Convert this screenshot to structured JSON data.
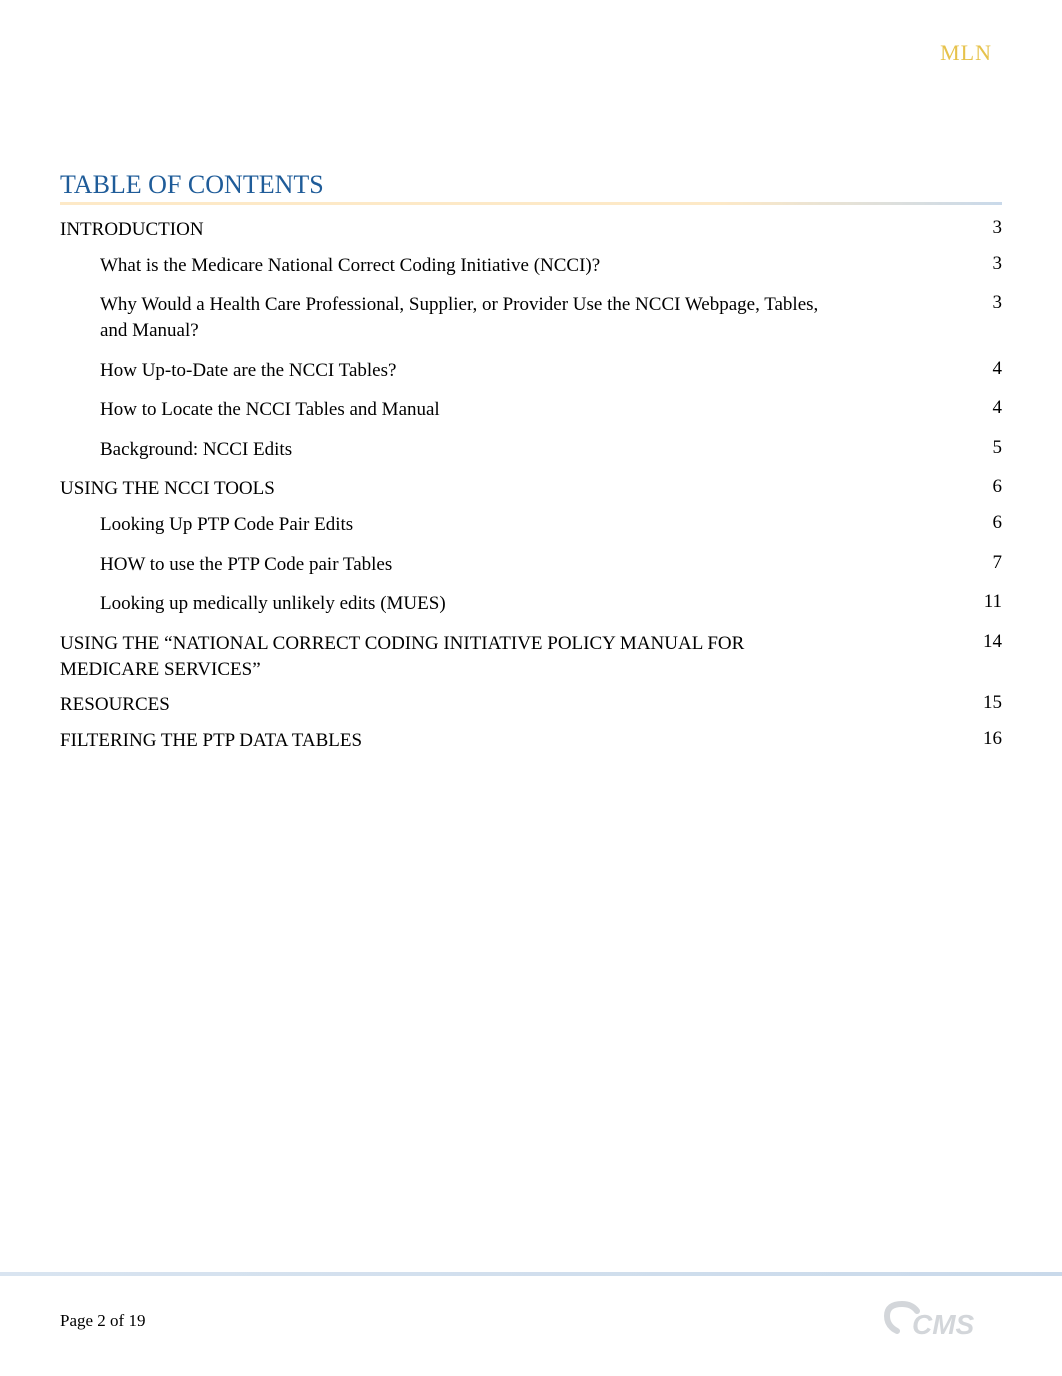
{
  "header": {
    "brand": "MLN",
    "brand_color": "#e6c24b"
  },
  "toc": {
    "heading": "TABLE OF CONTENTS",
    "heading_color": "#1f5c99",
    "entries": [
      {
        "level": "section",
        "title": "INTRODUCTION",
        "page": "3"
      },
      {
        "level": "sub",
        "title": "What is the Medicare National Correct Coding Initiative (NCCI)?",
        "page": "3"
      },
      {
        "level": "sub",
        "title": "Why Would a Health Care Professional, Supplier, or Provider Use the NCCI Webpage, Tables, and Manual?",
        "page": "3"
      },
      {
        "level": "sub",
        "title": "How Up-to-Date are the NCCI Tables?",
        "page": "4"
      },
      {
        "level": "sub",
        "title": "How to Locate the NCCI Tables and Manual",
        "page": "4"
      },
      {
        "level": "sub",
        "title": "Background: NCCI Edits",
        "page": "5"
      },
      {
        "level": "section",
        "title": "USING THE NCCI TOOLS",
        "page": "6"
      },
      {
        "level": "sub",
        "title": "Looking Up PTP Code Pair Edits",
        "page": "6"
      },
      {
        "level": "sub",
        "title": "HOW to use the PTP Code pair Tables",
        "page": "7"
      },
      {
        "level": "sub",
        "title": "Looking up medically unlikely edits (MUES)",
        "page": "11"
      },
      {
        "level": "section",
        "title": "USING THE “NATIONAL CORRECT CODING INITIATIVE POLICY MANUAL FOR MEDICARE SERVICES”",
        "page": "14"
      },
      {
        "level": "section",
        "title": "RESOURCES",
        "page": "15"
      },
      {
        "level": "section",
        "title": "FILTERING THE PTP DATA TABLES",
        "page": "16"
      }
    ]
  },
  "footer": {
    "page_label": "Page 2 of 19"
  }
}
